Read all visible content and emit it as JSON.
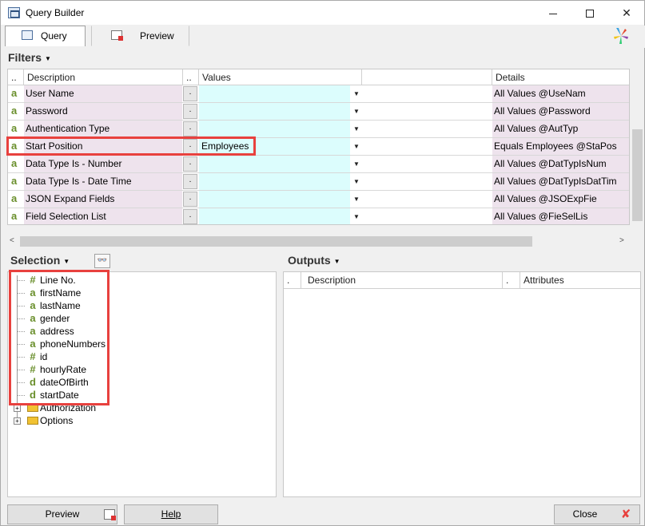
{
  "window": {
    "title": "Query Builder"
  },
  "tabs": [
    {
      "label": "Query",
      "active": true
    },
    {
      "label": "Preview",
      "active": false
    }
  ],
  "filters": {
    "title": "Filters",
    "columns": {
      "sel": "..",
      "description": "Description",
      "btn": "..",
      "values": "Values",
      "details": "Details"
    },
    "rows": [
      {
        "type": "a",
        "description": "User Name",
        "btn": ".",
        "value": "",
        "details": "All Values @UseNam"
      },
      {
        "type": "a",
        "description": "Password",
        "btn": ".",
        "value": "",
        "details": "All Values @Password"
      },
      {
        "type": "a",
        "description": "Authentication Type",
        "btn": ".",
        "value": "",
        "details": "All Values @AutTyp"
      },
      {
        "type": "a",
        "description": "Start Position",
        "btn": ".",
        "value": "Employees",
        "details": "Equals Employees @StaPos"
      },
      {
        "type": "a",
        "description": "Data Type Is - Number",
        "btn": ".",
        "value": "",
        "details": "All Values @DatTypIsNum"
      },
      {
        "type": "a",
        "description": "Data Type Is - Date Time",
        "btn": ".",
        "value": "",
        "details": "All Values @DatTypIsDatTim"
      },
      {
        "type": "a",
        "description": "JSON Expand Fields",
        "btn": ".",
        "value": "",
        "details": "All Values @JSOExpFie"
      },
      {
        "type": "a",
        "description": "Field Selection List",
        "btn": ".",
        "value": "",
        "details": "All Values @FieSelLis"
      }
    ]
  },
  "selection": {
    "title": "Selection",
    "fields": [
      {
        "glyph": "#",
        "label": "Line No."
      },
      {
        "glyph": "a",
        "label": "firstName"
      },
      {
        "glyph": "a",
        "label": "lastName"
      },
      {
        "glyph": "a",
        "label": "gender"
      },
      {
        "glyph": "a",
        "label": "address"
      },
      {
        "glyph": "a",
        "label": "phoneNumbers"
      },
      {
        "glyph": "#",
        "label": "id"
      },
      {
        "glyph": "#",
        "label": "hourlyRate"
      },
      {
        "glyph": "d",
        "label": "dateOfBirth"
      },
      {
        "glyph": "d",
        "label": "startDate"
      }
    ],
    "folders": [
      {
        "label": "Authorization"
      },
      {
        "label": "Options"
      }
    ]
  },
  "outputs": {
    "title": "Outputs",
    "columns": {
      "sel": ".",
      "description": "Description",
      "btn": ".",
      "attributes": "Attributes"
    }
  },
  "buttons": {
    "preview": "Preview",
    "help": "Help",
    "close": "Close"
  },
  "colors": {
    "highlight": "#e8413e",
    "desc_cell": "#eee3ed",
    "value_cell": "#dcfdfd",
    "type_icon": "#6a8f2c"
  }
}
